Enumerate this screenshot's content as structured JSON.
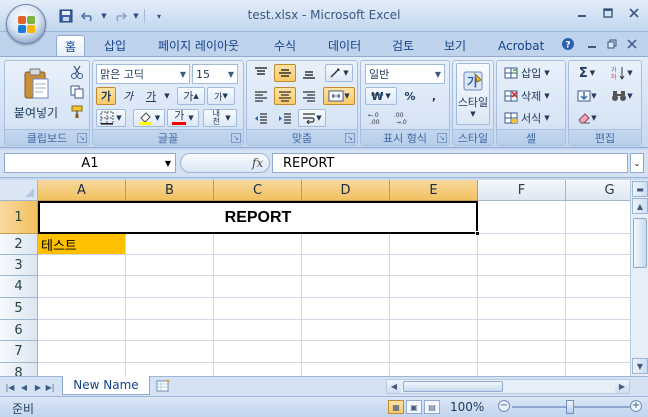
{
  "window": {
    "title": "test.xlsx - Microsoft Excel",
    "minimize_icon": "minimize-icon",
    "restore_icon": "restore-icon",
    "close_icon": "close-icon"
  },
  "quick_access": {
    "save_icon": "save-icon",
    "undo_icon": "undo-icon",
    "redo_icon": "redo-icon",
    "customize_icon": "chevron-down-icon"
  },
  "tabs": [
    {
      "label": "홈",
      "active": true
    },
    {
      "label": "삽입"
    },
    {
      "label": "페이지 레이아웃"
    },
    {
      "label": "수식"
    },
    {
      "label": "데이터"
    },
    {
      "label": "검토"
    },
    {
      "label": "보기"
    },
    {
      "label": "Acrobat"
    }
  ],
  "ribbon": {
    "clipboard": {
      "label": "클립보드",
      "paste": "붙여넣기"
    },
    "font": {
      "label": "글꼴",
      "font_name": "맑은 고딕",
      "font_size": "15",
      "bold": "가",
      "italic": "가",
      "underline": "가",
      "grow": "가",
      "shrink": "가",
      "font_color": "가",
      "phonetic": "내천"
    },
    "alignment": {
      "label": "맞춤"
    },
    "number": {
      "label": "표시 형식",
      "format": "일반",
      "currency": "₩",
      "percent": "%",
      "comma": ","
    },
    "styles": {
      "label": "스타일"
    },
    "cells": {
      "label": "셀",
      "insert": "삽입",
      "delete": "삭제",
      "format": "서식"
    },
    "editing": {
      "label": "편집"
    }
  },
  "formula_bar": {
    "name_box": "A1",
    "fx": "fx",
    "content": "REPORT"
  },
  "sheet": {
    "columns": [
      "A",
      "B",
      "C",
      "D",
      "E",
      "F",
      "G"
    ],
    "rows": [
      "1",
      "2",
      "3",
      "4",
      "5",
      "6",
      "7",
      "8"
    ],
    "merged_a1_e1": "REPORT",
    "cell_a2": "테스트",
    "highlight_color": "#ffc000"
  },
  "sheet_tabs": {
    "active": "New Name"
  },
  "status": {
    "text": "준비",
    "zoom": "100%"
  },
  "colors": {
    "accent": "#15428b",
    "selection_header": "#f1c15f"
  }
}
